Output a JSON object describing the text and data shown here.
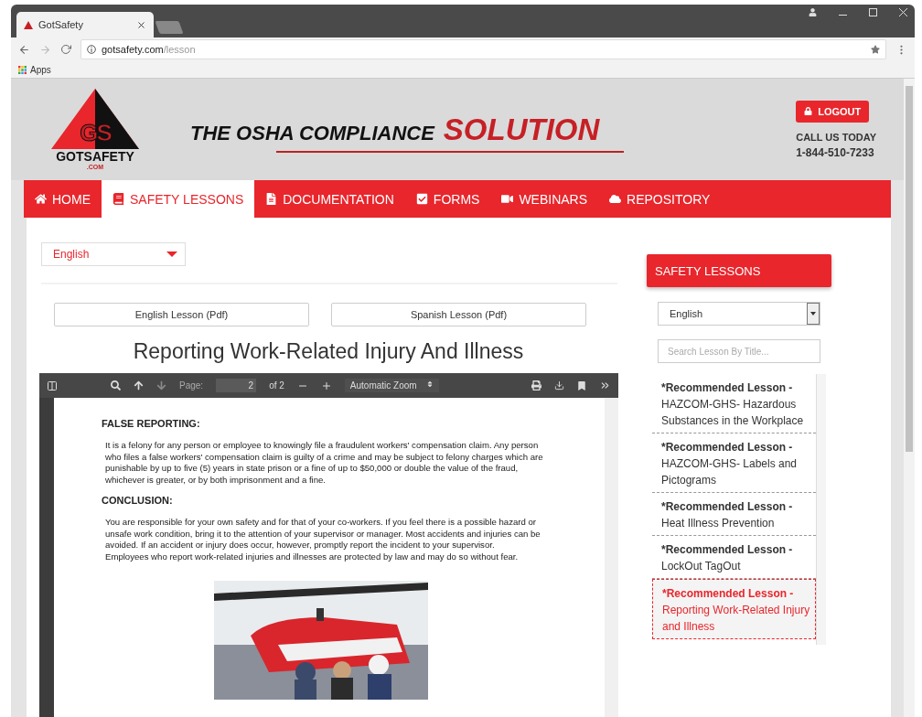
{
  "browser": {
    "tab_title": "GotSafety",
    "url_domain": "gotsafety.com",
    "url_path": "/lesson",
    "bookmarks": [
      "Apps"
    ]
  },
  "header": {
    "logo_initials": "GS",
    "logo_name": "GOTSAFETY",
    "logo_sub": ".COM",
    "tagline": "THE OSHA COMPLIANCE",
    "tagline_accent": "SOLUTION",
    "logout": "LOGOUT",
    "call": "CALL US TODAY",
    "phone": "1-844-510-7233"
  },
  "nav": [
    {
      "label": "HOME",
      "selected": false
    },
    {
      "label": "SAFETY LESSONS",
      "selected": true
    },
    {
      "label": "DOCUMENTATION",
      "selected": false
    },
    {
      "label": "FORMS",
      "selected": false
    },
    {
      "label": "WEBINARS",
      "selected": false
    },
    {
      "label": "REPOSITORY",
      "selected": false
    }
  ],
  "language_select": {
    "value": "English"
  },
  "pdf_buttons": [
    "English Lesson (Pdf)",
    "Spanish Lesson (Pdf)"
  ],
  "lesson_title": "Reporting Work-Related Injury And Illness",
  "pdf_viewer": {
    "page_label": "Page:",
    "page_value": "2",
    "page_count": "of 2",
    "zoom": "Automatic Zoom",
    "sections": [
      {
        "heading": "FALSE REPORTING:",
        "paragraphs": [
          "It is a felony for any person or employee to knowingly file a fraudulent workers' compensation claim. Any person who files a false workers' compensation claim is guilty of a crime and may be subject to felony charges which are punishable by up to five (5) years in state prison or a fine of up to $50,000 or double the value of the fraud, whichever is greater, or by both imprisonment and a fine."
        ]
      },
      {
        "heading": "CONCLUSION:",
        "paragraphs": [
          "You are responsible for your own safety and for that of your co-workers. If you feel there is a possible hazard or unsafe work condition, bring it to the attention of your supervisor or manager. Most accidents and injuries can be avoided. If an accident or injury does occur, however, promptly report the incident to your supervisor.",
          "Employees who report work-related injuries and illnesses are protected by law and may do so without fear."
        ]
      }
    ]
  },
  "sidebar": {
    "title": "SAFETY LESSONS",
    "language": "English",
    "search_placeholder": "Search Lesson By Title...",
    "lessons": [
      {
        "tag": "*Recommended Lesson -",
        "title": "HAZCOM-GHS- Hazardous Substances in the Workplace",
        "selected": false
      },
      {
        "tag": "*Recommended Lesson -",
        "title": "HAZCOM-GHS- Labels and Pictograms",
        "selected": false
      },
      {
        "tag": "*Recommended Lesson -",
        "title": "Heat Illness Prevention",
        "selected": false
      },
      {
        "tag": "*Recommended Lesson -",
        "title": "LockOut TagOut",
        "selected": false
      },
      {
        "tag": "*Recommended Lesson -",
        "title": "Reporting Work-Related Injury and Illness",
        "selected": true
      }
    ]
  }
}
